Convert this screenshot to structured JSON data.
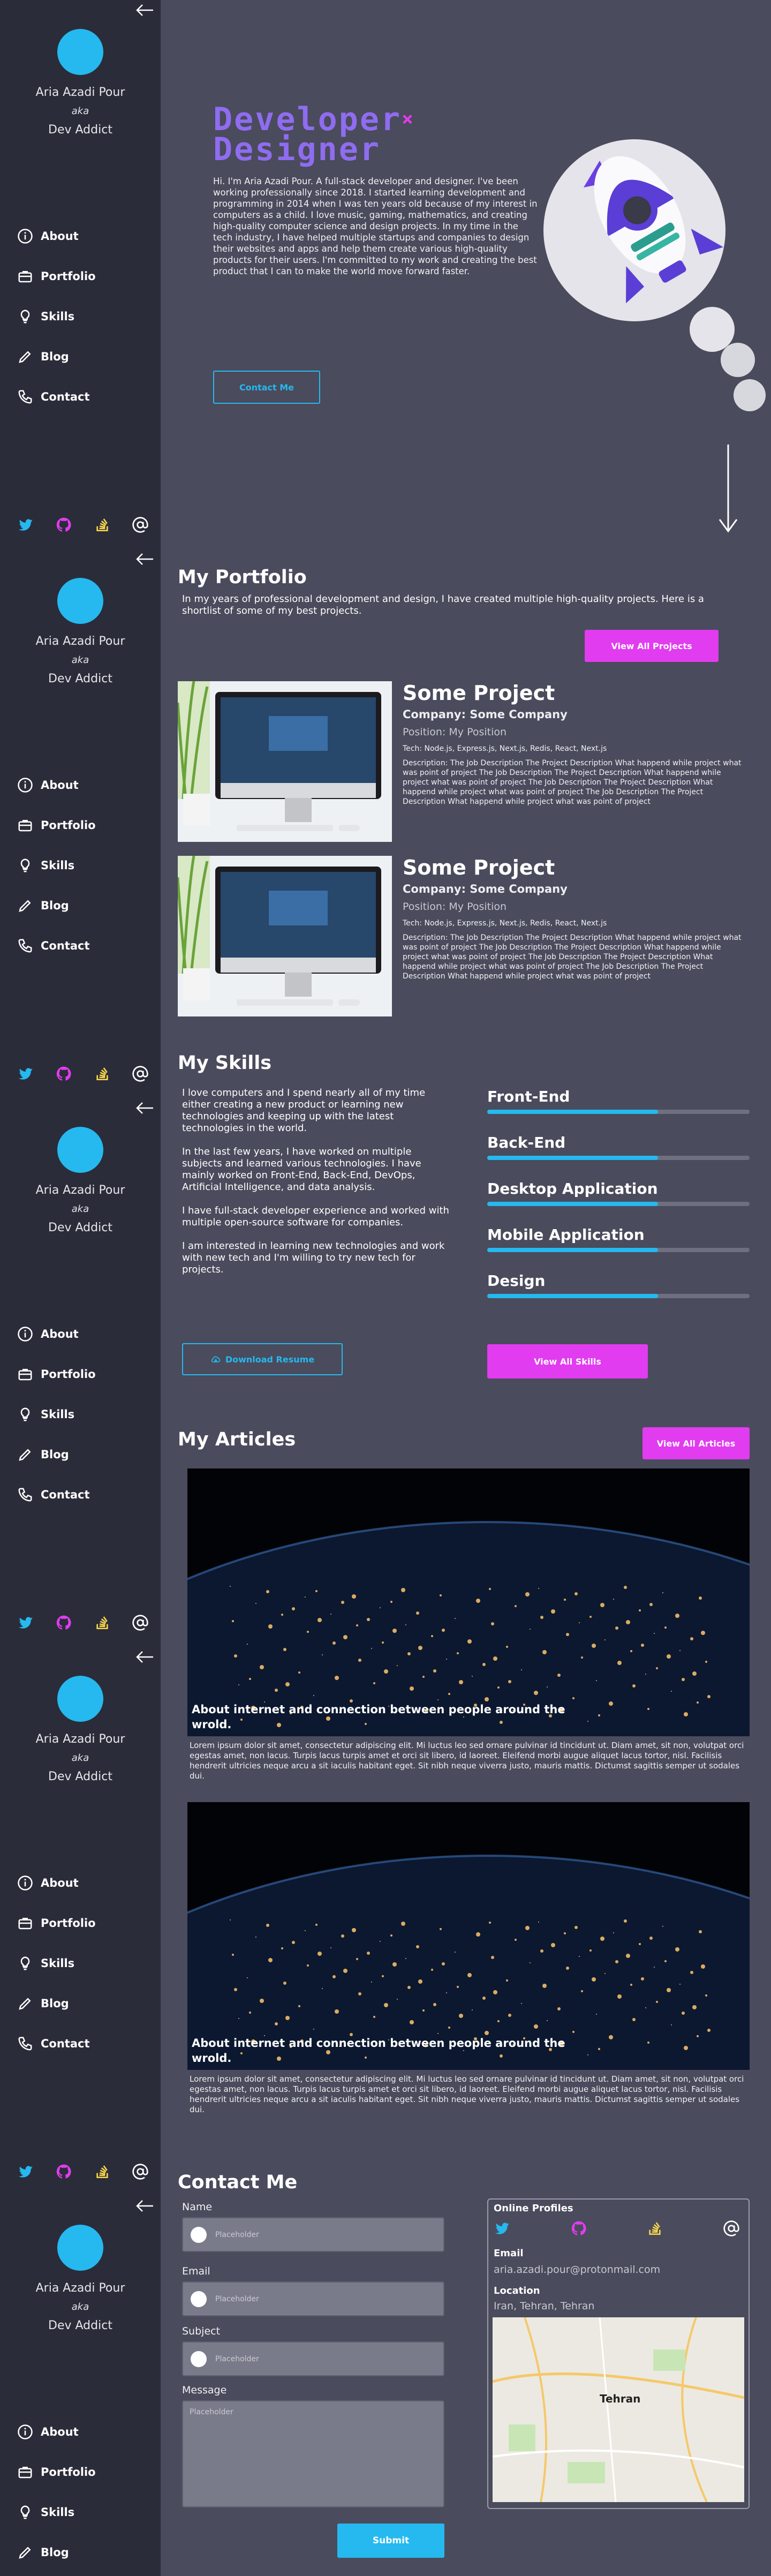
{
  "sidebar": {
    "name": "Aria Azadi Pour",
    "aka": "aka",
    "role": "Dev Addict",
    "nav": [
      {
        "label": "About",
        "icon": "info-icon"
      },
      {
        "label": "Portfolio",
        "icon": "briefcase-icon"
      },
      {
        "label": "Skills",
        "icon": "lightbulb-icon"
      },
      {
        "label": "Blog",
        "icon": "pencil-icon"
      },
      {
        "label": "Contact",
        "icon": "phone-icon"
      }
    ],
    "socials": [
      "twitter-icon",
      "github-icon",
      "stackoverflow-icon",
      "at-icon"
    ]
  },
  "hero": {
    "title_line1": "Developer",
    "title_x": "×",
    "title_line2": "Designer",
    "text": "Hi. I'm Aria Azadi Pour. A full-stack developer and designer. I've been working professionally since 2018. I started learning development and programming in 2014 when I was ten years old because of my interest in computers as a child. I love music, gaming, mathematics, and creating high-quality computer science and design projects. In my time in the tech industry, I have helped multiple startups and companies to design their websites and apps and help them create various high-quality products for their users. I'm committed to my work and creating the best product that I can to make the world move forward faster.",
    "cta": "Contact Me"
  },
  "portfolio": {
    "title": "My Portfolio",
    "intro": "In my years of professional development and design, I have created multiple high-quality projects. Here is a shortlist of some of my best projects.",
    "view_all": "View All Projects",
    "projects": [
      {
        "title": "Some Project",
        "company": "Company: Some Company",
        "position": "Position: My Position",
        "tech": "Tech: Node.js, Express.js, Next.js, Redis, React, Next.js",
        "description": "Description: The Job Description The Project Description What happend while project what was point of project The Job Description The Project Description What happend while project what was point of project The Job Description The Project Description What happend while project what was point of project The Job Description The Project Description What happend while project what was point of project"
      },
      {
        "title": "Some Project",
        "company": "Company: Some Company",
        "position": "Position: My Position",
        "tech": "Tech: Node.js, Express.js, Next.js, Redis, React, Next.js",
        "description": "Description: The Job Description The Project Description What happend while project what was point of project The Job Description The Project Description What happend while project what was point of project The Job Description The Project Description What happend while project what was point of project The Job Description The Project Description What happend while project what was point of project"
      }
    ]
  },
  "skills": {
    "title": "My Skills",
    "paragraphs": [
      "I love computers and I spend nearly all of my time either creating a new product or learning new technologies and keeping up with the latest technologies in the world.",
      "In the last few years, I have worked on multiple subjects and learned various technologies. I have mainly worked on Front-End, Back-End, DevOps, Artificial Intelligence, and data analysis.",
      "I have full-stack developer experience and worked with multiple open-source software for companies.",
      "I am interested in learning new technologies and work with new tech and I'm willing to try new tech for projects."
    ],
    "download": "Download Resume",
    "view_all": "View All Skills",
    "list": [
      {
        "name": "Front-End",
        "level": 0.65
      },
      {
        "name": "Back-End",
        "level": 0.65
      },
      {
        "name": "Desktop Application",
        "level": 0.65
      },
      {
        "name": "Mobile Application",
        "level": 0.65
      },
      {
        "name": "Design",
        "level": 0.65
      }
    ]
  },
  "articles": {
    "title": "My Articles",
    "view_all": "View All Articles",
    "items": [
      {
        "caption": "About internet and connection between people around the wrold.",
        "text": "Lorem ipsum dolor sit amet, consectetur adipiscing elit. Mi luctus leo sed ornare pulvinar id tincidunt ut. Diam amet, sit non, volutpat orci egestas amet, non lacus. Turpis lacus turpis amet et orci sit libero, id laoreet. Eleifend morbi augue aliquet lacus tortor, nisl. Facilisis hendrerit ultricies neque arcu a sit iaculis habitant eget. Sit nibh neque viverra justo, mauris mattis. Dictumst sagittis semper ut sodales dui."
      },
      {
        "caption": "About internet and connection between people around the wrold.",
        "text": "Lorem ipsum dolor sit amet, consectetur adipiscing elit. Mi luctus leo sed ornare pulvinar id tincidunt ut. Diam amet, sit non, volutpat orci egestas amet, non lacus. Turpis lacus turpis amet et orci sit libero, id laoreet. Eleifend morbi augue aliquet lacus tortor, nisl. Facilisis hendrerit ultricies neque arcu a sit iaculis habitant eget. Sit nibh neque viverra justo, mauris mattis. Dictumst sagittis semper ut sodales dui."
      }
    ]
  },
  "contact": {
    "title": "Contact Me",
    "fields": [
      {
        "label": "Name",
        "placeholder": "Placeholder"
      },
      {
        "label": "Email",
        "placeholder": "Placeholder"
      },
      {
        "label": "Subject",
        "placeholder": "Placeholder"
      }
    ],
    "message_label": "Message",
    "message_placeholder": "Placeholder",
    "submit": "Submit",
    "profiles_title": "Online Profiles",
    "email_title": "Email",
    "email": "aria.azadi.pour@protonmail.com",
    "location_title": "Location",
    "location": "Iran, Tehran, Tehran",
    "map_city": "Tehran"
  },
  "colors": {
    "accent": "#25b9ef",
    "pink": "#e13cf0",
    "purple": "#8f6cf0",
    "sidebar": "#2b2c39",
    "background": "#4a4b5c"
  }
}
